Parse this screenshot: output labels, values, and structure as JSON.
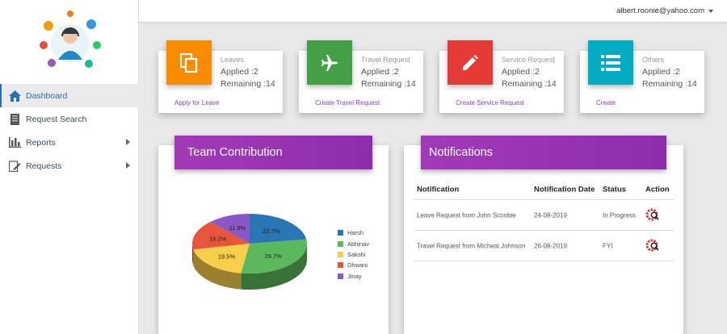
{
  "user": {
    "email": "albert.roonie@yahoo.com"
  },
  "sidebar": {
    "items": [
      {
        "label": "Dashboard",
        "icon": "home-icon",
        "active": true
      },
      {
        "label": "Request Search",
        "icon": "book-icon"
      },
      {
        "label": "Reports",
        "icon": "bar-chart-icon"
      },
      {
        "label": "Requests",
        "icon": "edit-document-icon"
      }
    ]
  },
  "cards": [
    {
      "title": "Leaves",
      "applied": "Applied :2",
      "remaining": "Remaining :14",
      "link": "Apply for Leave",
      "color": "#fb8c00",
      "icon": "copy-icon"
    },
    {
      "title": "Travel Request",
      "applied": "Applied :2",
      "remaining": "Remaining :14",
      "link": "Create Travel Request",
      "color": "#43a047",
      "icon": "airplane-icon"
    },
    {
      "title": "Service Request",
      "applied": "Applied :2",
      "remaining": "Remaining :14",
      "link": "Create Service Request",
      "color": "#e53935",
      "icon": "pencil-icon"
    },
    {
      "title": "Others",
      "applied": "Applied :2",
      "remaining": "Remaining :14",
      "link": "Create",
      "color": "#00acc1",
      "icon": "list-icon"
    }
  ],
  "team_panel": {
    "title": "Team Contribution"
  },
  "notifications": {
    "title": "Notifications",
    "columns": [
      "Notification",
      "Notification Date",
      "Status",
      "Action"
    ],
    "rows": [
      {
        "notification": "Leave Request from John Scoobie",
        "date": "24-08-2019",
        "status": "In Progress"
      },
      {
        "notification": "Travel Request from Micheal Johnson",
        "date": "26-08-2019",
        "status": "FYI"
      }
    ]
  },
  "chart_data": {
    "type": "pie",
    "title": "",
    "series": [
      {
        "name": "Harsh",
        "value": 22.7,
        "label": "22.7%",
        "color": "#2a75b3"
      },
      {
        "name": "Abhinav",
        "value": 29.7,
        "label": "29.7%",
        "color": "#5cb85c"
      },
      {
        "name": "Sakshi",
        "value": 19.5,
        "label": "19.5%",
        "color": "#f7cf4a"
      },
      {
        "name": "Dhwani",
        "value": 16.2,
        "label": "16.2%",
        "color": "#e8553d"
      },
      {
        "name": "Jinay",
        "value": 11.9,
        "label": "11.9%",
        "color": "#8a57c6"
      }
    ],
    "legend": "right"
  }
}
